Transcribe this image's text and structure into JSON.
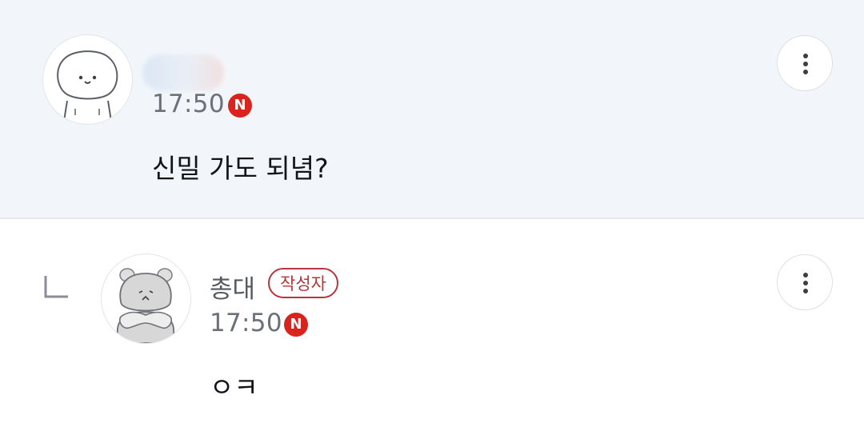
{
  "comments": [
    {
      "author": "",
      "time": "17:50",
      "new_badge": "N",
      "text": "신밀 가도 되념?",
      "more_icon": "more-vertical-icon"
    },
    {
      "author": "총대",
      "author_badge": "작성자",
      "time": "17:50",
      "new_badge": "N",
      "text": "ㅇㅋ",
      "more_icon": "more-vertical-icon",
      "reply_icon": "reply-indent-icon"
    }
  ],
  "colors": {
    "highlight_bg": "#f2f6fb",
    "new_badge": "#d9231c",
    "author_badge": "#b8353a"
  }
}
